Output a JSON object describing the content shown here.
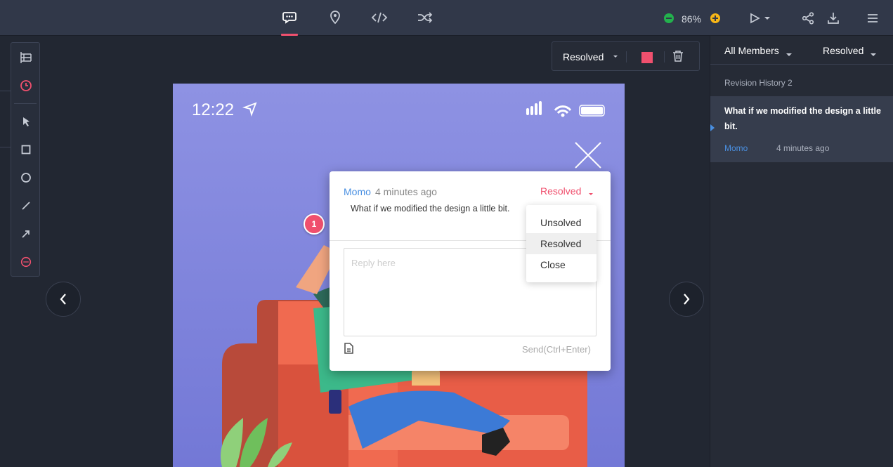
{
  "topbar": {
    "tabs": [
      {
        "name": "comment",
        "icon": "comment-icon",
        "active": true
      },
      {
        "name": "location",
        "icon": "location-pin-icon",
        "active": false
      },
      {
        "name": "code",
        "icon": "code-icon",
        "active": false
      },
      {
        "name": "shuffle",
        "icon": "shuffle-icon",
        "active": false
      }
    ],
    "zoom_label": "86%",
    "actions": [
      "play-icon",
      "share-icon",
      "download-icon",
      "menu-icon"
    ]
  },
  "tools": [
    "layers-icon",
    "history-icon",
    "pointer-icon",
    "rectangle-icon",
    "circle-icon",
    "line-icon",
    "arrow-icon",
    "comment-tool-icon"
  ],
  "float_toolbar": {
    "status_label": "Resolved",
    "swatch_color": "#f0506e"
  },
  "phone": {
    "time": "12:22"
  },
  "marker": {
    "number": "1"
  },
  "popover": {
    "author": "Momo",
    "time": "4 minutes ago",
    "status": "Resolved",
    "text": "What if we modified the design a little bit.",
    "reply_placeholder": "Reply here",
    "send_label": "Send(Ctrl+Enter)"
  },
  "dropdown": {
    "items": [
      "Unsolved",
      "Resolved",
      "Close"
    ],
    "hovered": "Resolved"
  },
  "right_panel": {
    "member_filter": "All Members",
    "status_filter": "Resolved",
    "history_label": "Revision History 2",
    "card": {
      "text": "What if we modified the design a little bit.",
      "author": "Momo",
      "time": "4 minutes ago"
    }
  },
  "colors": {
    "accent": "#f0506e",
    "link": "#4a90e2",
    "zoom_out": "#23b14d",
    "zoom_in": "#f7b617"
  }
}
